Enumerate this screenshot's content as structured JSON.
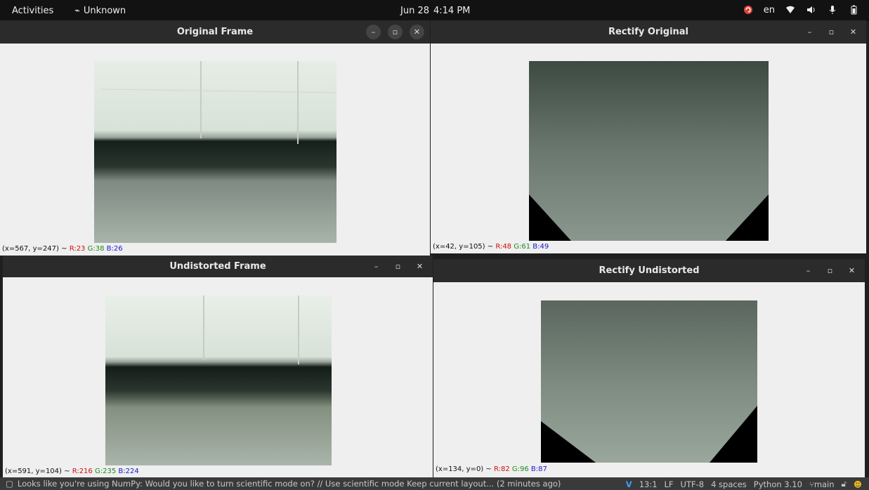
{
  "topbar": {
    "activities": "Activities",
    "app_name": "Unknown",
    "date": "Jun 28",
    "time": "4:14 PM",
    "language": "en"
  },
  "windows": {
    "original": {
      "title": "Original Frame",
      "coords": "(x=567, y=247) ~",
      "r": "R:23",
      "g": "G:38",
      "b": "B:26"
    },
    "rectify_original": {
      "title": "Rectify Original",
      "coords": "(x=42, y=105) ~",
      "r": "R:48",
      "g": "G:61",
      "b": "B:49"
    },
    "undistorted": {
      "title": "Undistorted Frame",
      "coords": "(x=591, y=104) ~",
      "r": "R:216",
      "g": "G:235",
      "b": "B:224"
    },
    "rectify_undistorted": {
      "title": "Rectify Undistorted",
      "coords": "(x=134, y=0) ~",
      "r": "R:82",
      "g": "G:96",
      "b": "B:87"
    }
  },
  "ide_status": {
    "message": "Looks like you're using NumPy: Would you like to turn scientific mode on? // Use scientific mode  Keep current layout... (2 minutes ago)",
    "position": "13:1",
    "line_ending": "LF",
    "encoding": "UTF-8",
    "indent": "4 spaces",
    "interpreter": "Python 3.10",
    "branch": "main"
  },
  "colors": {
    "topbar_bg": "#121212",
    "titlebar_bg": "#2b2b2b",
    "window_bg": "#efefef",
    "red": "#d01010",
    "green": "#1c8c1c",
    "blue": "#1818d0"
  }
}
